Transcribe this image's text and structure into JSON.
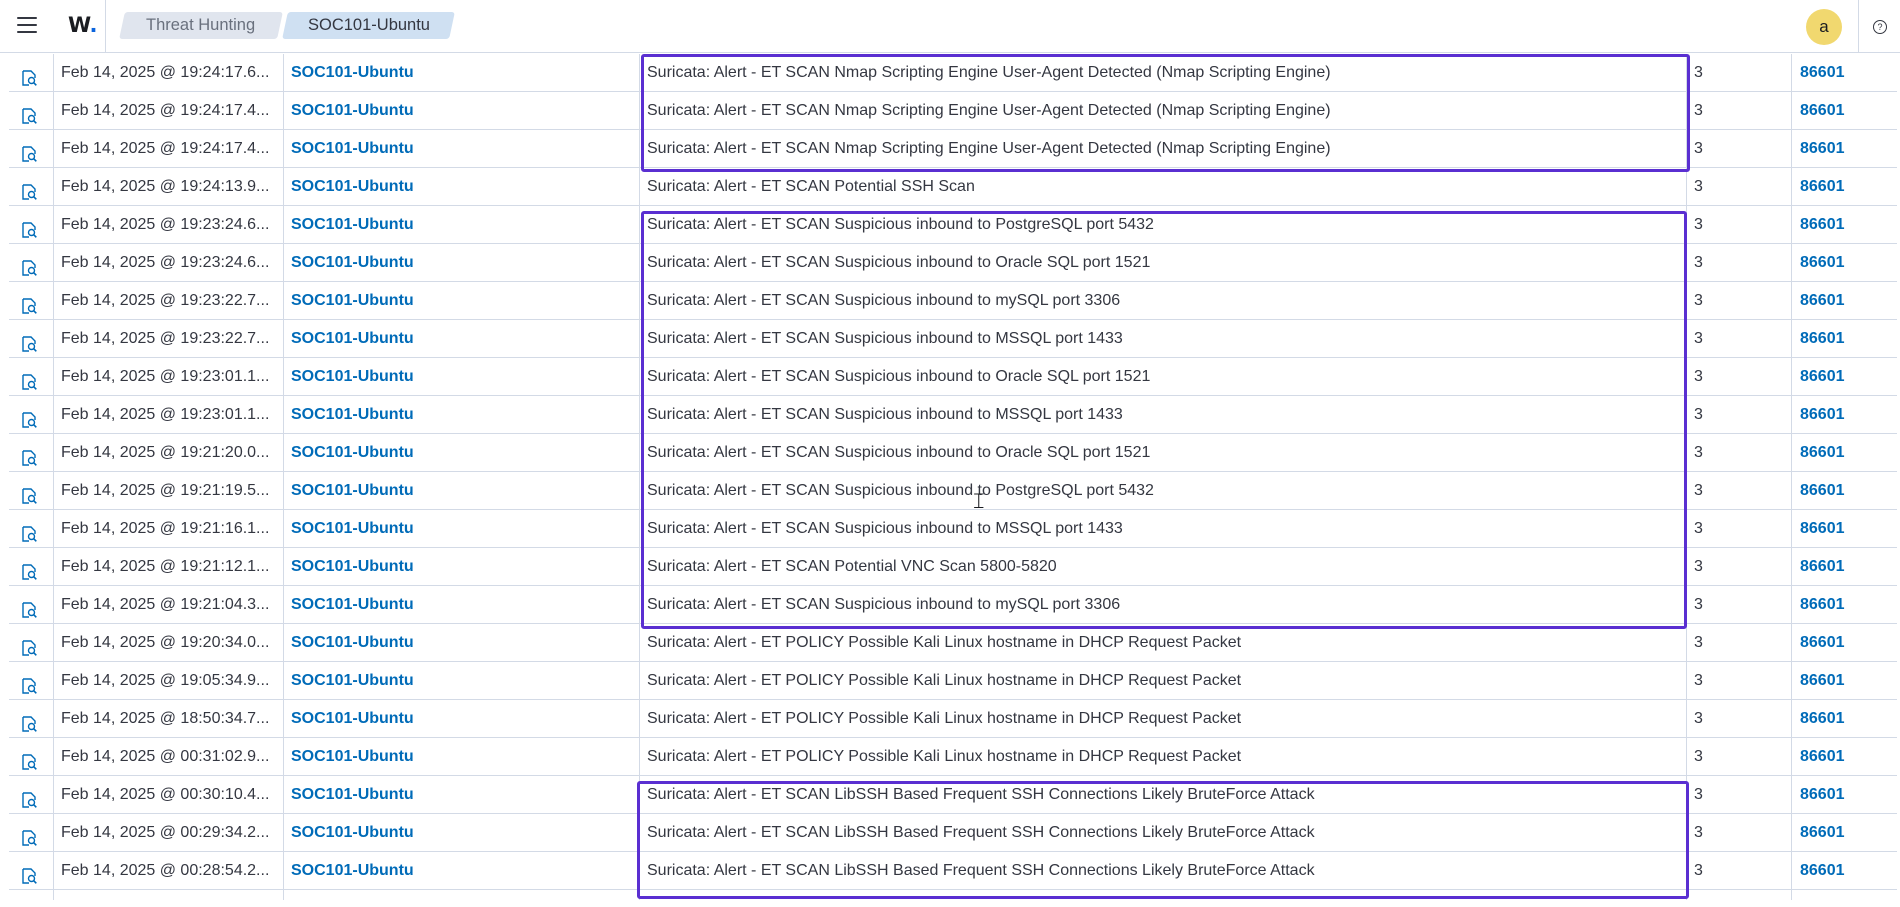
{
  "header": {
    "logo_text": "W",
    "logo_dot": ".",
    "breadcrumbs": [
      "Threat Hunting",
      "SOC101-Ubuntu"
    ],
    "avatar_initial": "a",
    "help_glyph": "?"
  },
  "colors": {
    "highlight": "#5a2fd1",
    "link": "#006bb8",
    "avatar": "#f1d86f"
  },
  "icons": {
    "row": "inspect-document-icon",
    "menu": "hamburger-menu-icon",
    "help": "help-circle-icon"
  },
  "table": {
    "rows": [
      {
        "time": "Feb 14, 2025 @ 19:24:17.6...",
        "agent": "SOC101-Ubuntu",
        "description": "Suricata: Alert - ET SCAN Nmap Scripting Engine User-Agent Detected (Nmap Scripting Engine)",
        "level": "3",
        "rule_id": "86601"
      },
      {
        "time": "Feb 14, 2025 @ 19:24:17.4...",
        "agent": "SOC101-Ubuntu",
        "description": "Suricata: Alert - ET SCAN Nmap Scripting Engine User-Agent Detected (Nmap Scripting Engine)",
        "level": "3",
        "rule_id": "86601"
      },
      {
        "time": "Feb 14, 2025 @ 19:24:17.4...",
        "agent": "SOC101-Ubuntu",
        "description": "Suricata: Alert - ET SCAN Nmap Scripting Engine User-Agent Detected (Nmap Scripting Engine)",
        "level": "3",
        "rule_id": "86601"
      },
      {
        "time": "Feb 14, 2025 @ 19:24:13.9...",
        "agent": "SOC101-Ubuntu",
        "description": "Suricata: Alert - ET SCAN Potential SSH Scan",
        "level": "3",
        "rule_id": "86601"
      },
      {
        "time": "Feb 14, 2025 @ 19:23:24.6...",
        "agent": "SOC101-Ubuntu",
        "description": "Suricata: Alert - ET SCAN Suspicious inbound to PostgreSQL port 5432",
        "level": "3",
        "rule_id": "86601"
      },
      {
        "time": "Feb 14, 2025 @ 19:23:24.6...",
        "agent": "SOC101-Ubuntu",
        "description": "Suricata: Alert - ET SCAN Suspicious inbound to Oracle SQL port 1521",
        "level": "3",
        "rule_id": "86601"
      },
      {
        "time": "Feb 14, 2025 @ 19:23:22.7...",
        "agent": "SOC101-Ubuntu",
        "description": "Suricata: Alert - ET SCAN Suspicious inbound to mySQL port 3306",
        "level": "3",
        "rule_id": "86601"
      },
      {
        "time": "Feb 14, 2025 @ 19:23:22.7...",
        "agent": "SOC101-Ubuntu",
        "description": "Suricata: Alert - ET SCAN Suspicious inbound to MSSQL port 1433",
        "level": "3",
        "rule_id": "86601"
      },
      {
        "time": "Feb 14, 2025 @ 19:23:01.1...",
        "agent": "SOC101-Ubuntu",
        "description": "Suricata: Alert - ET SCAN Suspicious inbound to Oracle SQL port 1521",
        "level": "3",
        "rule_id": "86601"
      },
      {
        "time": "Feb 14, 2025 @ 19:23:01.1...",
        "agent": "SOC101-Ubuntu",
        "description": "Suricata: Alert - ET SCAN Suspicious inbound to MSSQL port 1433",
        "level": "3",
        "rule_id": "86601"
      },
      {
        "time": "Feb 14, 2025 @ 19:21:20.0...",
        "agent": "SOC101-Ubuntu",
        "description": "Suricata: Alert - ET SCAN Suspicious inbound to Oracle SQL port 1521",
        "level": "3",
        "rule_id": "86601"
      },
      {
        "time": "Feb 14, 2025 @ 19:21:19.5...",
        "agent": "SOC101-Ubuntu",
        "description": "Suricata: Alert - ET SCAN Suspicious inbound to PostgreSQL port 5432",
        "level": "3",
        "rule_id": "86601"
      },
      {
        "time": "Feb 14, 2025 @ 19:21:16.1...",
        "agent": "SOC101-Ubuntu",
        "description": "Suricata: Alert - ET SCAN Suspicious inbound to MSSQL port 1433",
        "level": "3",
        "rule_id": "86601"
      },
      {
        "time": "Feb 14, 2025 @ 19:21:12.1...",
        "agent": "SOC101-Ubuntu",
        "description": "Suricata: Alert - ET SCAN Potential VNC Scan 5800-5820",
        "level": "3",
        "rule_id": "86601"
      },
      {
        "time": "Feb 14, 2025 @ 19:21:04.3...",
        "agent": "SOC101-Ubuntu",
        "description": "Suricata: Alert - ET SCAN Suspicious inbound to mySQL port 3306",
        "level": "3",
        "rule_id": "86601"
      },
      {
        "time": "Feb 14, 2025 @ 19:20:34.0...",
        "agent": "SOC101-Ubuntu",
        "description": "Suricata: Alert - ET POLICY Possible Kali Linux hostname in DHCP Request Packet",
        "level": "3",
        "rule_id": "86601"
      },
      {
        "time": "Feb 14, 2025 @ 19:05:34.9...",
        "agent": "SOC101-Ubuntu",
        "description": "Suricata: Alert - ET POLICY Possible Kali Linux hostname in DHCP Request Packet",
        "level": "3",
        "rule_id": "86601"
      },
      {
        "time": "Feb 14, 2025 @ 18:50:34.7...",
        "agent": "SOC101-Ubuntu",
        "description": "Suricata: Alert - ET POLICY Possible Kali Linux hostname in DHCP Request Packet",
        "level": "3",
        "rule_id": "86601"
      },
      {
        "time": "Feb 14, 2025 @ 00:31:02.9...",
        "agent": "SOC101-Ubuntu",
        "description": "Suricata: Alert - ET POLICY Possible Kali Linux hostname in DHCP Request Packet",
        "level": "3",
        "rule_id": "86601"
      },
      {
        "time": "Feb 14, 2025 @ 00:30:10.4...",
        "agent": "SOC101-Ubuntu",
        "description": "Suricata: Alert - ET SCAN LibSSH Based Frequent SSH Connections Likely BruteForce Attack",
        "level": "3",
        "rule_id": "86601"
      },
      {
        "time": "Feb 14, 2025 @ 00:29:34.2...",
        "agent": "SOC101-Ubuntu",
        "description": "Suricata: Alert - ET SCAN LibSSH Based Frequent SSH Connections Likely BruteForce Attack",
        "level": "3",
        "rule_id": "86601"
      },
      {
        "time": "Feb 14, 2025 @ 00:28:54.2...",
        "agent": "SOC101-Ubuntu",
        "description": "Suricata: Alert - ET SCAN LibSSH Based Frequent SSH Connections Likely BruteForce Attack",
        "level": "3",
        "rule_id": "86601"
      }
    ]
  }
}
